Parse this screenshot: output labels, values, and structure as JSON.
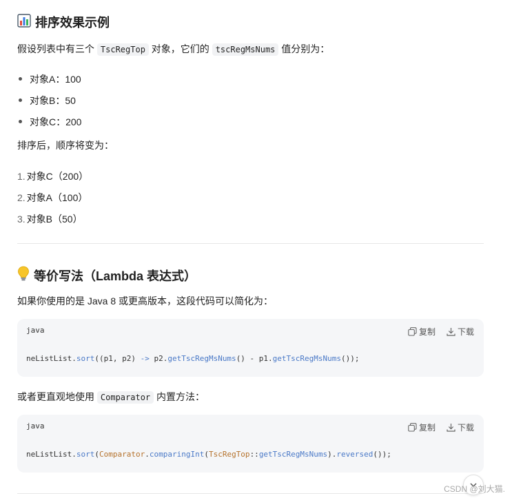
{
  "section1": {
    "icon": "chart-icon",
    "title": "排序效果示例",
    "intro_before": "假设列表中有三个 ",
    "intro_code1": "TscRegTop",
    "intro_mid": " 对象，它们的 ",
    "intro_code2": "tscRegMsNums",
    "intro_after": " 值分别为：",
    "bullets": [
      "对象A：100",
      "对象B：50",
      "对象C：200"
    ],
    "after_text": "排序后，顺序将变为：",
    "ordered": [
      {
        "num": "1.",
        "text": "对象C（200）"
      },
      {
        "num": "2.",
        "text": "对象A（100）"
      },
      {
        "num": "3.",
        "text": "对象B（50）"
      }
    ]
  },
  "section2": {
    "icon": "lightbulb-icon",
    "title": "等价写法（Lambda 表达式）",
    "intro": "如果你使用的是 Java 8 或更高版本，这段代码可以简化为：",
    "code1": {
      "lang": "java",
      "copy": "复制",
      "download": "下载",
      "parts": [
        "neListList.",
        "sort",
        "((p1, p2) ",
        "->",
        " p2.",
        "getTscRegMsNums",
        "() - p1.",
        "getTscRegMsNums",
        "());"
      ]
    },
    "middle_before": "或者更直观地使用 ",
    "middle_code": "Comparator",
    "middle_after": " 内置方法：",
    "code2": {
      "lang": "java",
      "copy": "复制",
      "download": "下载",
      "parts": [
        "neListList.",
        "sort",
        "(",
        "Comparator",
        ".",
        "comparingInt",
        "(",
        "TscRegTop",
        "::",
        "getTscRegMsNums",
        ").",
        "reversed",
        "());"
      ]
    }
  },
  "watermark": "CSDN @刘大猫."
}
